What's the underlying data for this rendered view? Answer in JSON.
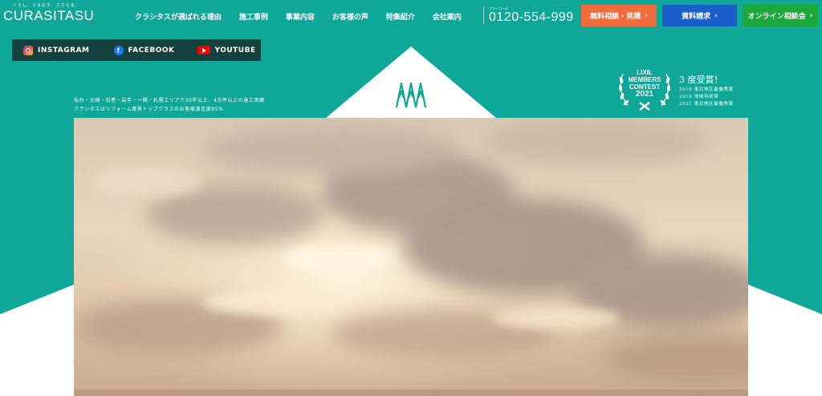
{
  "logo": {
    "tagline": "くらし、うるおす、ささえる。",
    "brand": "CURASITASU"
  },
  "nav": [
    {
      "label": "クラシタスが選ばれる理由"
    },
    {
      "label": "施工事例"
    },
    {
      "label": "事業内容"
    },
    {
      "label": "お客様の声"
    },
    {
      "label": "特集紹介"
    },
    {
      "label": "会社案内"
    }
  ],
  "phone": {
    "free_label": "フリーコール",
    "number": "0120-554-999"
  },
  "buttons": {
    "consult": "無料相談・見積",
    "docs": "資料請求",
    "online": "オンライン相談会"
  },
  "social": [
    {
      "label": "INSTAGRAM",
      "icon": "instagram-icon"
    },
    {
      "label": "FACEBOOK",
      "icon": "facebook-icon"
    },
    {
      "label": "YOUTUBE",
      "icon": "youtube-icon"
    }
  ],
  "intro": {
    "line1": "仙台・大崎・石巻・岩手・一関・札幌エリアで30年以上、4万件以上の施工実績",
    "line2": "クラシタスはリフォーム業界トップクラスのお客様満足度95%"
  },
  "award": {
    "badge_line1": "LIXIL",
    "badge_line2": "MEMBERS",
    "badge_line3": "CONTEST",
    "badge_year": "2021",
    "count": "3 度受賞！",
    "items": [
      "2018 東北地区最優秀賞",
      "2019 地域特別賞",
      "2021 東北地区最優秀賞"
    ]
  },
  "colors": {
    "teal": "#0fa797",
    "consult": "#f26b3a",
    "docs": "#1a5fc9",
    "online": "#1aa83a",
    "social_bar": "#14413d"
  }
}
